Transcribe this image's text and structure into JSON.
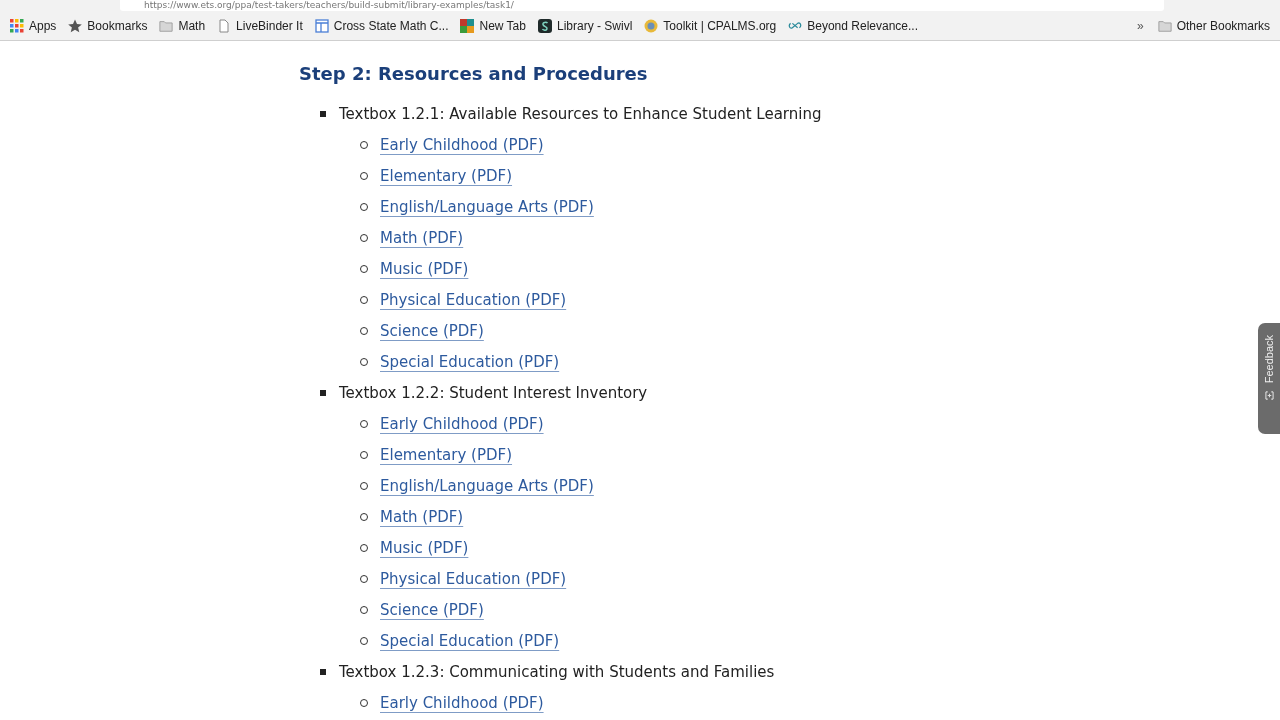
{
  "address_bar": {
    "url": "https://www.ets.org/ppa/test-takers/teachers/build-submit/library-examples/task1/"
  },
  "bookmarks_bar": {
    "items": [
      {
        "label": "Apps",
        "kind": "apps"
      },
      {
        "label": "Bookmarks",
        "kind": "star"
      },
      {
        "label": "Math",
        "kind": "folder"
      },
      {
        "label": "LiveBinder It",
        "kind": "page"
      },
      {
        "label": "Cross State Math C...",
        "kind": "layout"
      },
      {
        "label": "New Tab",
        "kind": "tiles"
      },
      {
        "label": "Library - Swivl",
        "kind": "swivl"
      },
      {
        "label": "Toolkit | CPALMS.org",
        "kind": "badge"
      },
      {
        "label": "Beyond Relevance...",
        "kind": "infinity"
      }
    ],
    "overflow": "»",
    "other": "Other Bookmarks"
  },
  "heading": "Step 2: Resources and Procedures",
  "sections": [
    {
      "title": "Textbox 1.2.1: Available Resources to Enhance Student Learning",
      "links": [
        "Early Childhood (PDF)",
        "Elementary (PDF)",
        "English/Language Arts (PDF)",
        "Math (PDF)",
        "Music (PDF)",
        "Physical Education (PDF)",
        "Science (PDF)",
        "Special Education (PDF)"
      ]
    },
    {
      "title": "Textbox 1.2.2: Student Interest Inventory",
      "links": [
        "Early Childhood (PDF)",
        "Elementary (PDF)",
        "English/Language Arts (PDF)",
        "Math (PDF)",
        "Music (PDF)",
        "Physical Education (PDF)",
        "Science (PDF)",
        "Special Education (PDF)"
      ]
    },
    {
      "title": "Textbox 1.2.3: Communicating with Students and Families",
      "links": [
        "Early Childhood (PDF)"
      ]
    }
  ],
  "feedback_tab": {
    "label": "Feedback"
  }
}
